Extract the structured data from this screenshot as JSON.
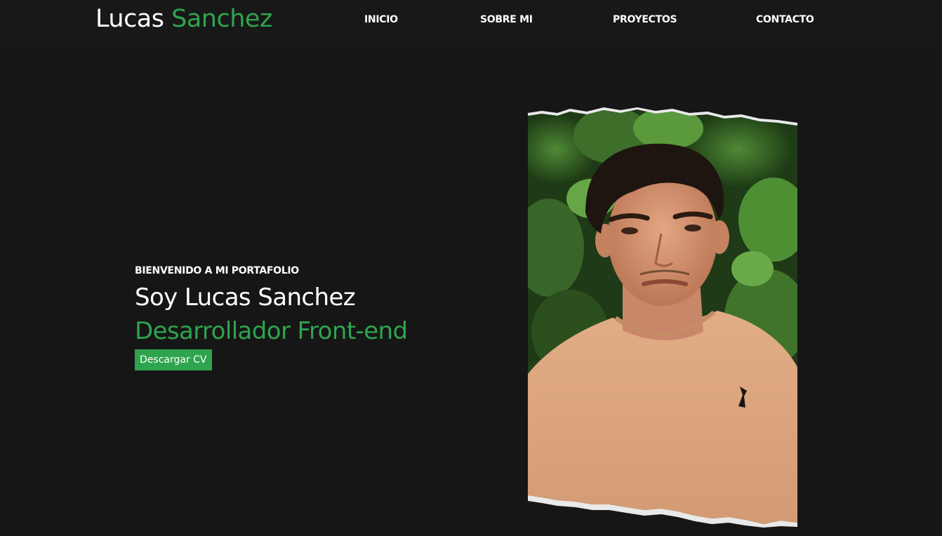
{
  "header": {
    "logo_first": "Lucas",
    "logo_last": "Sanchez",
    "nav": {
      "inicio": "INICIO",
      "sobre_mi": "SOBRE MI",
      "proyectos": "PROYECTOS",
      "contacto": "CONTACTO"
    }
  },
  "hero": {
    "eyebrow": "BIENVENIDO A MI PORTAFOLIO",
    "title": "Soy Lucas Sanchez",
    "role": "Desarrollador Front-end",
    "cv_button": "Descargar CV"
  },
  "colors": {
    "background": "#161616",
    "accent": "#2ea44f",
    "text": "#ffffff"
  },
  "icons": {
    "photo": "profile-photo"
  }
}
